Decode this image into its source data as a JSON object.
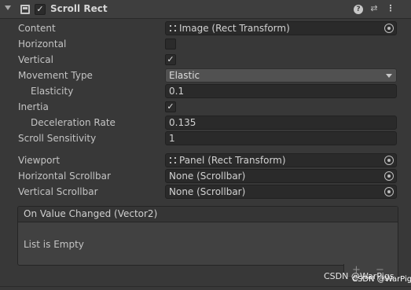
{
  "component": {
    "title": "Scroll Rect",
    "enabled_mark": "✓"
  },
  "header_icons": {
    "fold": "foldout-arrow-icon",
    "component": "scroll-rect-component-icon",
    "help": "?",
    "preset": "⇄",
    "menu": "⋮"
  },
  "properties": {
    "content": {
      "label": "Content",
      "value": "Image (Rect Transform)"
    },
    "horizontal": {
      "label": "Horizontal",
      "checked": false
    },
    "vertical": {
      "label": "Vertical",
      "checked": true,
      "mark": "✓"
    },
    "movement_type": {
      "label": "Movement Type",
      "value": "Elastic"
    },
    "elasticity": {
      "label": "Elasticity",
      "value": "0.1"
    },
    "inertia": {
      "label": "Inertia",
      "checked": true,
      "mark": "✓"
    },
    "deceleration_rate": {
      "label": "Deceleration Rate",
      "value": "0.135"
    },
    "scroll_sensitivity": {
      "label": "Scroll Sensitivity",
      "value": "1"
    },
    "viewport": {
      "label": "Viewport",
      "value": "Panel (Rect Transform)"
    },
    "horizontal_scrollbar": {
      "label": "Horizontal Scrollbar",
      "value": "None (Scrollbar)"
    },
    "vertical_scrollbar": {
      "label": "Vertical Scrollbar",
      "value": "None (Scrollbar)"
    }
  },
  "event": {
    "title": "On Value Changed (Vector2)",
    "empty_text": "List is Empty",
    "add": "+",
    "remove": "−"
  },
  "watermark": {
    "text": "CSDN @WarPigs",
    "text2": "CSDN @WarPigs"
  },
  "colors": {
    "background": "#383838",
    "field": "#2a2a2a",
    "dropdown": "#515151",
    "text": "#c4c4c4"
  }
}
